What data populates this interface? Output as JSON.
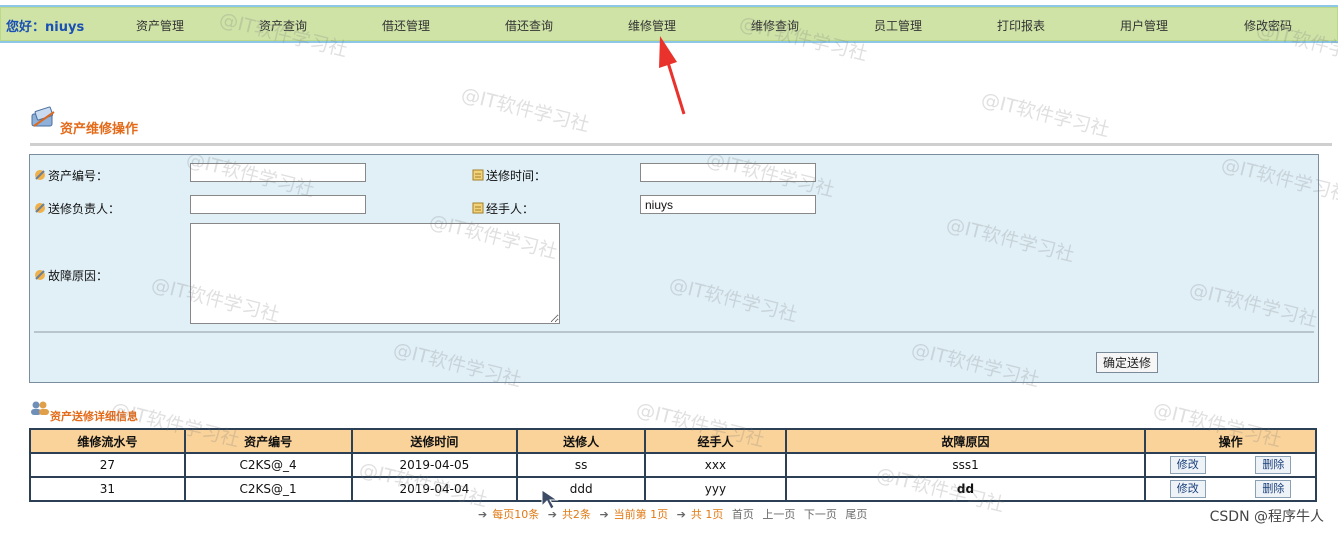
{
  "header": {
    "greeting": "您好：niuys",
    "nav": [
      "资产管理",
      "资产查询",
      "借还管理",
      "借还查询",
      "维修管理",
      "维修查询",
      "员工管理",
      "打印报表",
      "用户管理",
      "修改密码"
    ]
  },
  "section": {
    "title": "资产维修操作"
  },
  "form": {
    "asset_no_label": "资产编号：",
    "asset_no_value": "",
    "send_time_label": "送修时间：",
    "send_time_value": "",
    "responsible_label": "送修负责人：",
    "responsible_value": "",
    "handler_label": "经手人：",
    "handler_value": "niuys",
    "reason_label": "故障原因：",
    "reason_value": "",
    "submit_label": "确定送修"
  },
  "table": {
    "title": "资产送修详细信息",
    "headers": [
      "维修流水号",
      "资产编号",
      "送修时间",
      "送修人",
      "经手人",
      "故障原因",
      "操作"
    ],
    "rows": [
      {
        "id": "27",
        "asset_no": "C2KS@_4",
        "time": "2019-04-05",
        "sender": "ss",
        "handler": "xxx",
        "reason": "sss1"
      },
      {
        "id": "31",
        "asset_no": "C2KS@_1",
        "time": "2019-04-04",
        "sender": "ddd",
        "handler": "yyy",
        "reason": "dd"
      }
    ],
    "edit_label": "修改",
    "delete_label": "删除"
  },
  "pager": {
    "per_page": "每页10条",
    "total": "共2条",
    "current": "当前第 1页",
    "pages": "共 1页",
    "first": "首页",
    "prev": "上一页",
    "next": "下一页",
    "last": "尾页"
  },
  "watermark": "@IT软件学习社",
  "credit": "CSDN @程序牛人",
  "colors": {
    "nav_bg": "#cfe3a7",
    "table_header_bg": "#fad39a",
    "form_bg": "#e1f0f7",
    "accent_orange": "#e36b1a",
    "arrow_red": "#e8322b"
  }
}
